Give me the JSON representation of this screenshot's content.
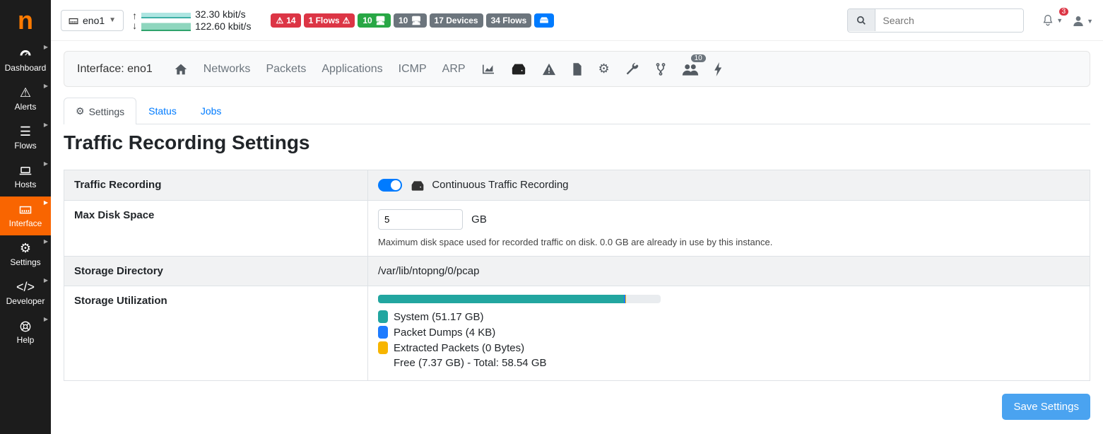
{
  "sidebar": {
    "items": [
      {
        "label": "Dashboard"
      },
      {
        "label": "Alerts"
      },
      {
        "label": "Flows"
      },
      {
        "label": "Hosts"
      },
      {
        "label": "Interface"
      },
      {
        "label": "Settings"
      },
      {
        "label": "Developer"
      },
      {
        "label": "Help"
      }
    ]
  },
  "topbar": {
    "interface": "eno1",
    "up_rate": "32.30 kbit/s",
    "down_rate": "122.60 kbit/s",
    "badges": {
      "alerts": "14",
      "flows_alert": "1 Flows",
      "hosts_green": "10",
      "hosts_gray": "10",
      "devices": "17 Devices",
      "flows": "34 Flows"
    },
    "search_placeholder": "Search",
    "bell_count": "3"
  },
  "panel": {
    "interface_label": "Interface: eno1",
    "links": [
      "Networks",
      "Packets",
      "Applications",
      "ICMP",
      "ARP"
    ],
    "users_badge": "10"
  },
  "tabs": {
    "settings": "Settings",
    "status": "Status",
    "jobs": "Jobs"
  },
  "page_title": "Traffic Recording Settings",
  "rows": {
    "traffic_recording": {
      "label": "Traffic Recording",
      "desc": "Continuous Traffic Recording"
    },
    "max_disk": {
      "label": "Max Disk Space",
      "value": "5",
      "unit": "GB",
      "help": "Maximum disk space used for recorded traffic on disk. 0.0 GB are already in use by this instance."
    },
    "storage_dir": {
      "label": "Storage Directory",
      "value": "/var/lib/ntopng/0/pcap"
    },
    "storage_util": {
      "label": "Storage Utilization",
      "system": "System (51.17 GB)",
      "dumps": "Packet Dumps (4 KB)",
      "extracted": "Extracted Packets (0 Bytes)",
      "free_total": "Free (7.37 GB)   -   Total: 58.54 GB",
      "pct_system": 87,
      "pct_dumps": 0.5,
      "pct_ext": 0.3
    }
  },
  "save_button": "Save Settings"
}
